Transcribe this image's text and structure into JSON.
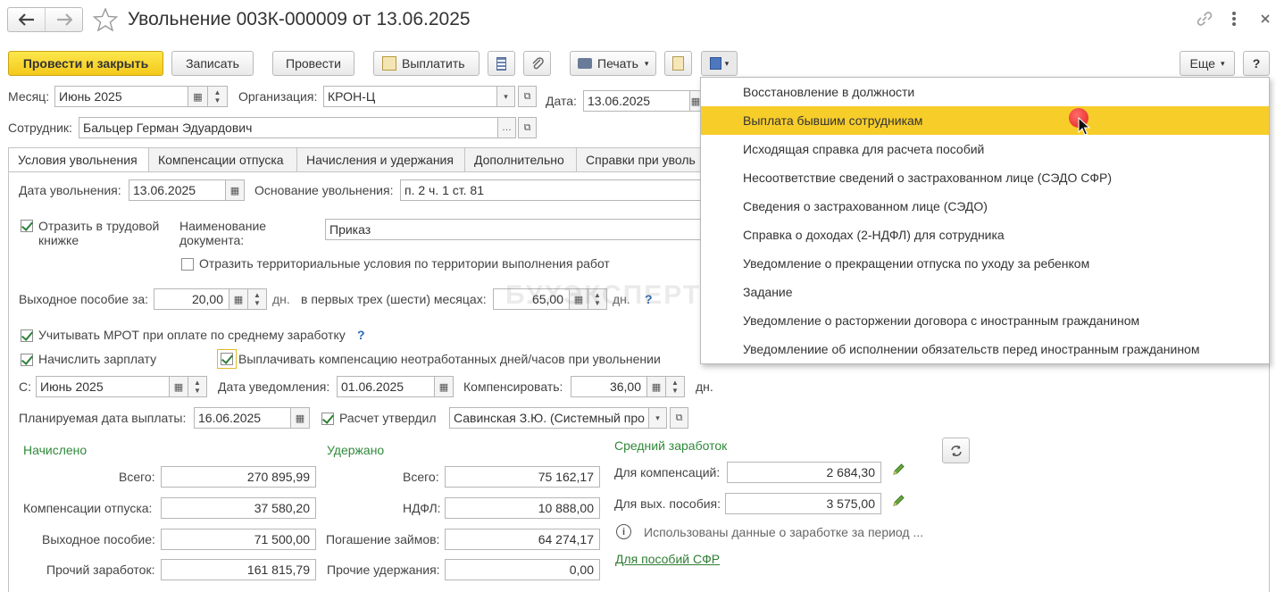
{
  "window": {
    "title": "Увольнение 003К-000009 от 13.06.2025"
  },
  "toolbar": {
    "post_close": "Провести и закрыть",
    "save": "Записать",
    "post": "Провести",
    "pay": "Выплатить",
    "print": "Печать",
    "more": "Еще",
    "help": "?"
  },
  "header": {
    "month_label": "Месяц:",
    "month_value": "Июнь 2025",
    "org_label": "Организация:",
    "org_value": "КРОН-Ц",
    "date_label": "Дата:",
    "date_value": "13.06.2025",
    "employee_label": "Сотрудник:",
    "employee_value": "Бальцер Герман Эдуардович"
  },
  "tabs": [
    "Условия увольнения",
    "Компенсации отпуска",
    "Начисления и удержания",
    "Дополнительно",
    "Справки при уволь"
  ],
  "form": {
    "dismissal_date_label": "Дата увольнения:",
    "dismissal_date": "13.06.2025",
    "basis_label": "Основание увольнения:",
    "basis_value": "п. 2 ч. 1 ст. 81",
    "workbook_label_1": "Отразить в трудовой",
    "workbook_label_2": "книжке",
    "doc_name_label_1": "Наименование",
    "doc_name_label_2": "документа:",
    "doc_name_value": "Приказ",
    "territorial_label": "Отразить территориальные условия по территории выполнения работ",
    "severance_label": "Выходное пособие за:",
    "severance_value": "20,00",
    "days_unit": "дн.",
    "first_months_label": "в первых трех (шести) месяцах:",
    "first_months_value": "65,00",
    "question": "?",
    "mrot_label": "Учитывать МРОТ при оплате по среднему заработку",
    "calc_salary_label": "Начислить зарплату",
    "pay_comp_label": "Выплачивать компенсацию неотработанных дней/часов при увольнении",
    "from_label": "С:",
    "from_value": "Июнь 2025",
    "notice_label": "Дата уведомления:",
    "notice_value": "01.06.2025",
    "compensate_label": "Компенсировать:",
    "compensate_value": "36,00",
    "planned_label": "Планируемая дата выплаты:",
    "planned_value": "16.06.2025",
    "approved_label": "Расчет утвердил",
    "approved_value": "Савинская З.Ю. (Системный про"
  },
  "accrued": {
    "title": "Начислено",
    "rows": [
      {
        "label": "Всего:",
        "value": "270 895,99"
      },
      {
        "label": "Компенсации отпуска:",
        "value": "37 580,20"
      },
      {
        "label": "Выходное пособие:",
        "value": "71 500,00"
      },
      {
        "label": "Прочий заработок:",
        "value": "161 815,79"
      }
    ]
  },
  "withheld": {
    "title": "Удержано",
    "rows": [
      {
        "label": "Всего:",
        "value": "75 162,17"
      },
      {
        "label": "НДФЛ:",
        "value": "10 888,00"
      },
      {
        "label": "Погашение займов:",
        "value": "64 274,17"
      },
      {
        "label": "Прочие удержания:",
        "value": "0,00"
      }
    ]
  },
  "average": {
    "title": "Средний заработок",
    "comp_label": "Для компенсаций:",
    "comp_value": "2 684,30",
    "severance_label": "Для вых. пособия:",
    "severance_value": "3 575,00",
    "info": "Использованы данные о заработке за период ...",
    "sfr_link": "Для пособий СФР"
  },
  "watermark": "БУХЭКСПЕРТ",
  "menu": {
    "items": [
      "Восстановление в должности",
      "Выплата бывшим сотрудникам",
      "Исходящая справка для расчета пособий",
      "Несоответствие сведений о застрахованном лице (СЭДО СФР)",
      "Сведения о застрахованном лице (СЭДО)",
      "Справка о доходах (2-НДФЛ) для сотрудника",
      "Уведомление о прекращении отпуска по уходу за ребенком",
      "Задание",
      "Уведомление о расторжении договора с иностранным гражданином",
      "Уведомлениие об исполнении обязательств перед иностранным гражданином"
    ],
    "highlight_color": "#f7cd2a"
  }
}
